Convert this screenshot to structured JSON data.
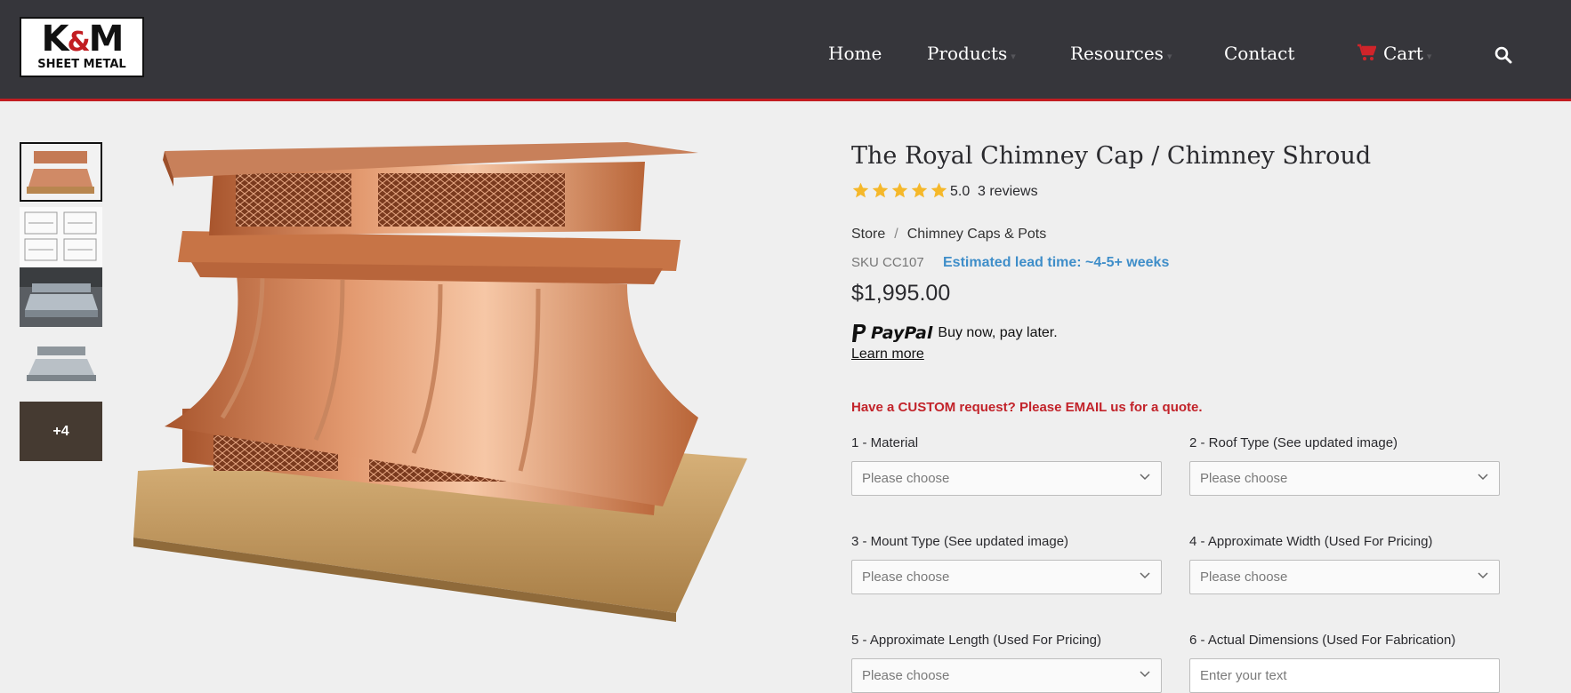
{
  "header": {
    "logo_top": "K",
    "logo_top_amp": "&",
    "logo_top_end": "M",
    "logo_bottom": "SHEET METAL",
    "nav": [
      {
        "label": "Home"
      },
      {
        "label": "Products"
      },
      {
        "label": "Resources"
      },
      {
        "label": "Contact"
      },
      {
        "label": "Cart"
      }
    ],
    "accent_color": "#c21d21"
  },
  "gallery": {
    "more_label": "+4"
  },
  "product": {
    "title": "The Royal Chimney Cap / Chimney Shroud",
    "rating": "5.0",
    "stars": 5,
    "reviews": "3 reviews",
    "breadcrumb": [
      "Store",
      "Chimney Caps & Pots"
    ],
    "breadcrumb_sep": "/",
    "sku": "SKU CC107",
    "lead_time": "Estimated lead time: ~4-5+ weeks",
    "price": "$1,995.00",
    "paypal_word": "PayPal",
    "paypal_tagline": "Buy now, pay later.",
    "learn_more": "Learn more",
    "custom_request": "Have a CUSTOM request? Please EMAIL us for a quote."
  },
  "options": [
    {
      "label": "1 - Material",
      "placeholder": "Please choose"
    },
    {
      "label": "2 - Roof Type (See updated image)",
      "placeholder": "Please choose"
    },
    {
      "label": "3 - Mount Type (See updated image)",
      "placeholder": "Please choose"
    },
    {
      "label": "4 - Approximate Width (Used For Pricing)",
      "placeholder": "Please choose"
    },
    {
      "label": "5 - Approximate Length (Used For Pricing)",
      "placeholder": "Please choose"
    },
    {
      "label": "6 - Actual Dimensions (Used For Fabrication)",
      "placeholder": "Enter your text"
    }
  ]
}
